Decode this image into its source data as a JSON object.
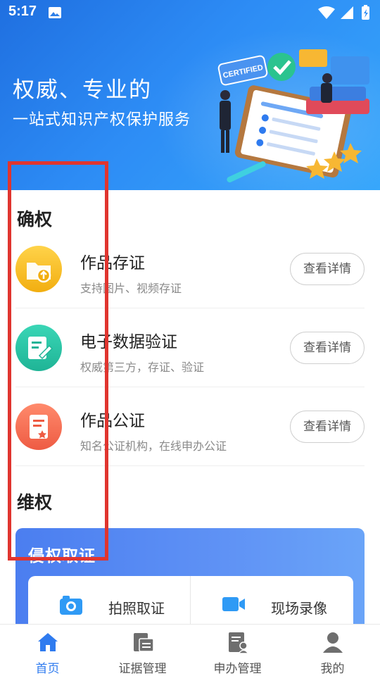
{
  "status_bar": {
    "time": "5:17"
  },
  "banner": {
    "title": "权威、专业的",
    "subtitle": "一站式知识产权保护服务",
    "badge_text": "CERTIFIED"
  },
  "confirm_section": {
    "title": "确权",
    "items": [
      {
        "name": "作品存证",
        "desc": "支持图片、视频存证",
        "button": "查看详情",
        "icon": "folder-upload-icon",
        "color": "#f6b21c"
      },
      {
        "name": "电子数据验证",
        "desc": "权威第三方，存证、验证",
        "button": "查看详情",
        "icon": "verify-document-icon",
        "color": "#27c2a2"
      },
      {
        "name": "作品公证",
        "desc": "知名公证机构，在线申办公证",
        "button": "查看详情",
        "icon": "notary-document-icon",
        "color": "#f0674f"
      }
    ]
  },
  "protect_section": {
    "title": "维权",
    "card_title": "侵权取证",
    "actions": [
      {
        "label": "拍照取证",
        "icon": "camera-icon"
      },
      {
        "label": "现场录像",
        "icon": "video-camera-icon"
      }
    ]
  },
  "bottom_nav": {
    "items": [
      {
        "label": "首页",
        "icon": "home-icon",
        "active": true
      },
      {
        "label": "证据管理",
        "icon": "evidence-folder-icon",
        "active": false
      },
      {
        "label": "申办管理",
        "icon": "application-manage-icon",
        "active": false
      },
      {
        "label": "我的",
        "icon": "profile-icon",
        "active": false
      }
    ]
  },
  "colors": {
    "accent": "#2f7bef",
    "banner": "#2d8cf5",
    "annotation": "#e0352f"
  }
}
